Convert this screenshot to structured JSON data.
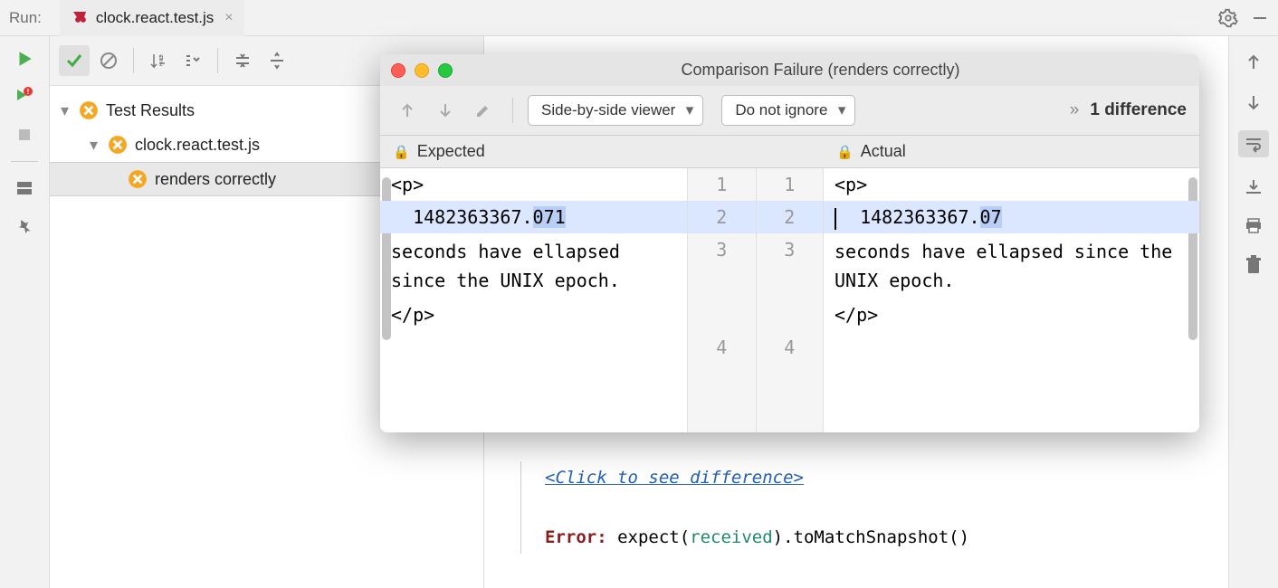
{
  "topbar": {
    "run_label": "Run:",
    "tab_name": "clock.react.test.js"
  },
  "tree": {
    "root": "Test Results",
    "file": "clock.react.test.js",
    "test": "renders correctly"
  },
  "console": {
    "diff_link": "<Click to see difference>",
    "error_prefix": "Error:",
    "expect": " expect(",
    "received": "received",
    "tail": ").toMatchSnapshot()"
  },
  "modal": {
    "title": "Comparison Failure (renders correctly)",
    "viewer_mode": "Side-by-side viewer",
    "ignore_mode": "Do not ignore",
    "diff_count": "1 difference",
    "expected_label": "Expected",
    "actual_label": "Actual",
    "expected_lines": {
      "l1": "<p>",
      "l2_pre": "  1482363367.",
      "l2_hl": "071",
      "l3": "   seconds have ellapsed since the UNIX epoch.",
      "l4": "</p>"
    },
    "actual_lines": {
      "l1": "<p>",
      "l2_pre": "  1482363367.",
      "l2_hl": "07",
      "l3": "   seconds have ellapsed since the UNIX epoch.",
      "l4": "</p>"
    },
    "gutter_left": [
      "1",
      "2",
      "3",
      "",
      "",
      "4"
    ],
    "gutter_right": [
      "1",
      "2",
      "3",
      "",
      "",
      "4"
    ]
  }
}
